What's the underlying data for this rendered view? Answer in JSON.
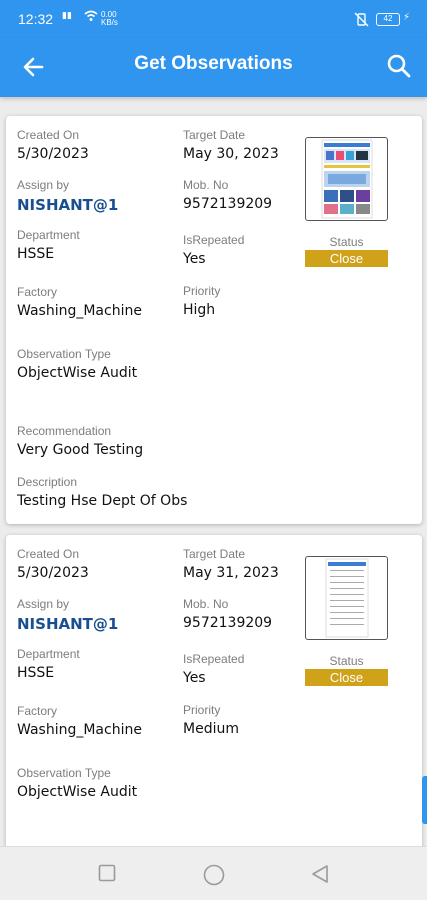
{
  "status_bar": {
    "time": "12:32",
    "data_label": "0.00\nKB/s",
    "battery": "42"
  },
  "header": {
    "title": "Get Observations",
    "back_icon": "arrow-left-icon",
    "search_icon": "search-icon"
  },
  "labels": {
    "created_on": "Created On",
    "target_date": "Target Date",
    "assign_by": "Assign by",
    "mob_no": "Mob. No",
    "department": "Department",
    "is_repeated": "IsRepeated",
    "status": "Status",
    "factory": "Factory",
    "priority": "Priority",
    "observation_type": "Observation Type",
    "recommendation": "Recommendation",
    "description": "Description"
  },
  "observations": [
    {
      "created_on": "5/30/2023",
      "target_date": "May 30, 2023",
      "assign_by": "NISHANT@1",
      "mob_no": "9572139209",
      "department": "HSSE",
      "is_repeated": "Yes",
      "status": "Close",
      "factory": "Washing_Machine",
      "priority": "High",
      "observation_type": "ObjectWise Audit",
      "recommendation": "Very Good Testing",
      "description": "Testing Hse Dept Of Obs"
    },
    {
      "created_on": "5/30/2023",
      "target_date": "May 31, 2023",
      "assign_by": "NISHANT@1",
      "mob_no": "9572139209",
      "department": "HSSE",
      "is_repeated": "Yes",
      "status": "Close",
      "factory": "Washing_Machine",
      "priority": "Medium",
      "observation_type": "ObjectWise Audit"
    }
  ],
  "nav": {
    "square_icon": "recent-apps-icon",
    "circle_icon": "home-icon",
    "triangle_icon": "back-triangle-icon"
  },
  "colors": {
    "primary": "#2f95ee",
    "status_close": "#cfa21a",
    "assignee": "#1a4f8f"
  }
}
